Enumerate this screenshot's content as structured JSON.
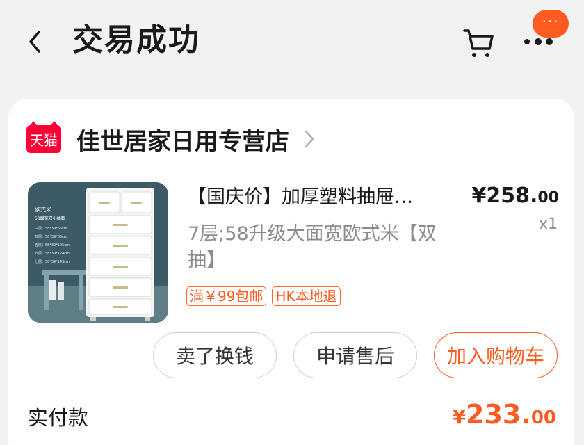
{
  "header": {
    "title": "交易成功",
    "more_badge": "···"
  },
  "shop": {
    "logo_text": "天猫",
    "name": "佳世居家日用专营店"
  },
  "product": {
    "title": "【国庆价】加厚塑料抽屉…",
    "spec": "7层;58升级大面宽欧式米【双抽】",
    "price_main": "¥258.",
    "price_decimal": "00",
    "quantity": "x1",
    "tags": [
      "满￥99包邮",
      "HK本地退"
    ],
    "image_caption": {
      "line1": "欧式米",
      "line2": "58面宽双小抽数",
      "rows": [
        "三层：58*39*65cm",
        "四层：58*39*85cm",
        "五层：58*39*105cm",
        "六层：58*39*124cm",
        "七层：58*39*143cm"
      ]
    }
  },
  "actions": {
    "sell": "卖了换钱",
    "after_sale": "申请售后",
    "add_cart": "加入购物车"
  },
  "payment": {
    "label": "实付款",
    "yen": "¥",
    "amount_main": "233.",
    "amount_decimal": "00"
  },
  "colors": {
    "accent": "#ff5a1f",
    "tmall_red": "#ff0036",
    "background": "#f2f2f2"
  }
}
